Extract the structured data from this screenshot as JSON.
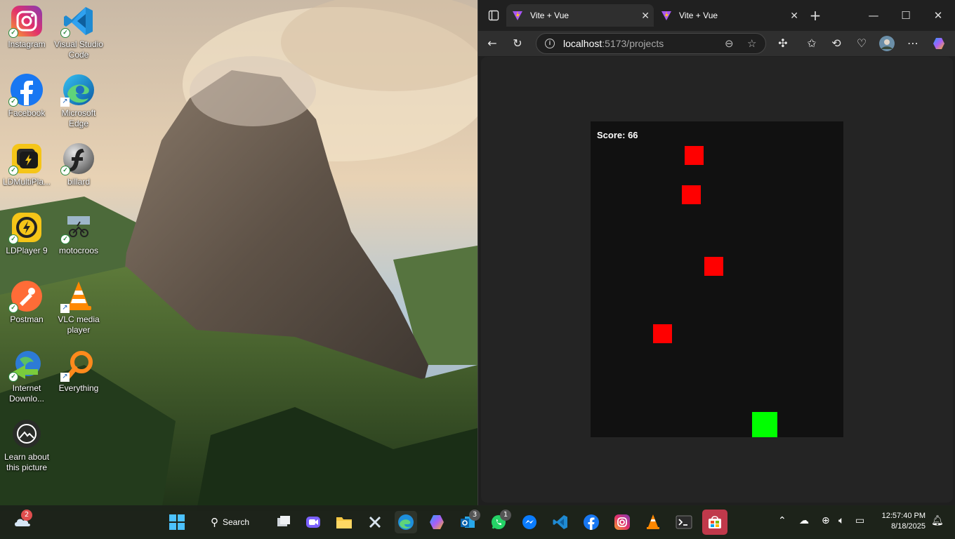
{
  "desktop": {
    "icons": [
      {
        "label": "Instagram",
        "icon": "instagram-icon"
      },
      {
        "label": "Visual Studio Code",
        "icon": "vscode-icon"
      },
      {
        "label": "Facebook",
        "icon": "facebook-icon"
      },
      {
        "label": "Microsoft Edge",
        "icon": "edge-icon"
      },
      {
        "label": "LDMultiPla...",
        "icon": "ldmultiplayer-icon"
      },
      {
        "label": "billard",
        "icon": "billard-icon"
      },
      {
        "label": "LDPlayer 9",
        "icon": "ldplayer-icon"
      },
      {
        "label": "motocroos",
        "icon": "motocross-icon"
      },
      {
        "label": "Postman",
        "icon": "postman-icon"
      },
      {
        "label": "VLC media player",
        "icon": "vlc-icon"
      },
      {
        "label": "Internet Downlo...",
        "icon": "idm-icon"
      },
      {
        "label": "Everything",
        "icon": "everything-icon"
      },
      {
        "label": "Learn about this picture",
        "icon": "learn-picture-icon"
      }
    ]
  },
  "browser": {
    "tabs": [
      {
        "title": "Vite + Vue",
        "active": true
      },
      {
        "title": "Vite + Vue",
        "active": false
      }
    ],
    "new_tab": "+",
    "window_controls": {
      "minimize": "—",
      "maximize": "☐",
      "close": "✕"
    },
    "address": {
      "host": "localhost",
      "path": ":5173/projects"
    }
  },
  "game": {
    "score_text": "Score: 66",
    "colors": {
      "background": "#111111",
      "obstacle": "#ff0000",
      "player": "#00ff00"
    }
  },
  "taskbar": {
    "search_label": "Search",
    "weather_badge": "2",
    "outlook_badge": "3",
    "whatsapp_badge": "1",
    "time": "12:57:40 PM",
    "date": "8/18/2025"
  }
}
